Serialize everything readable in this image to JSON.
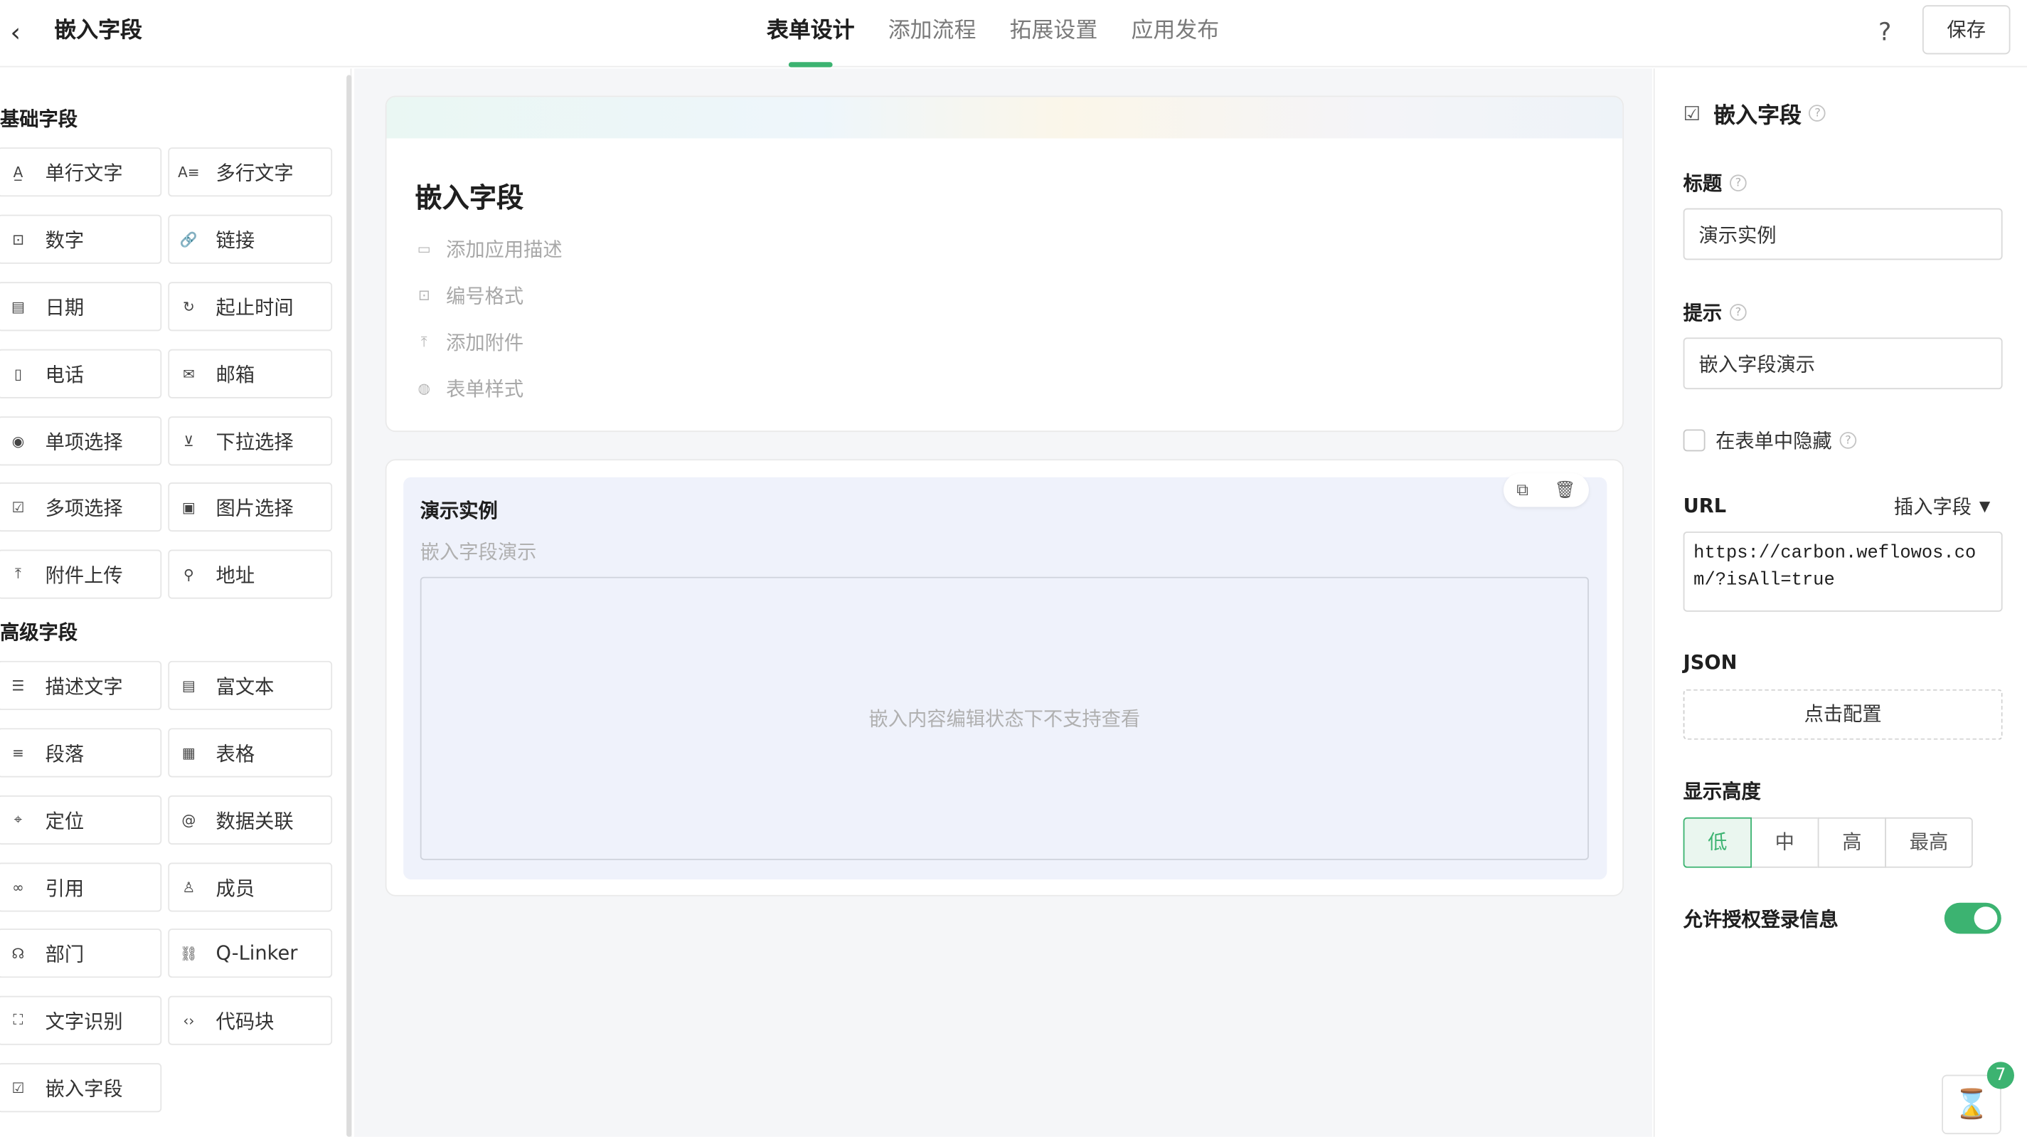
{
  "header": {
    "back_icon": "chevron-left-icon",
    "title": "嵌入字段",
    "tabs": [
      {
        "label": "表单设计",
        "active": true
      },
      {
        "label": "添加流程",
        "active": false
      },
      {
        "label": "拓展设置",
        "active": false
      },
      {
        "label": "应用发布",
        "active": false
      }
    ],
    "help_label": "?",
    "save_label": "保存"
  },
  "palette": {
    "basic_title": "基础字段",
    "basic_fields": [
      {
        "label": "单行文字",
        "icon": "text-icon"
      },
      {
        "label": "多行文字",
        "icon": "multiline-icon"
      },
      {
        "label": "数字",
        "icon": "number-icon"
      },
      {
        "label": "链接",
        "icon": "link-icon"
      },
      {
        "label": "日期",
        "icon": "calendar-icon"
      },
      {
        "label": "起止时间",
        "icon": "time-range-icon"
      },
      {
        "label": "电话",
        "icon": "phone-icon"
      },
      {
        "label": "邮箱",
        "icon": "mail-icon"
      },
      {
        "label": "单项选择",
        "icon": "radio-icon"
      },
      {
        "label": "下拉选择",
        "icon": "dropdown-icon"
      },
      {
        "label": "多项选择",
        "icon": "checkbox-icon"
      },
      {
        "label": "图片选择",
        "icon": "image-icon"
      },
      {
        "label": "附件上传",
        "icon": "upload-icon"
      },
      {
        "label": "地址",
        "icon": "address-icon"
      }
    ],
    "advanced_title": "高级字段",
    "advanced_fields": [
      {
        "label": "描述文字",
        "icon": "description-icon"
      },
      {
        "label": "富文本",
        "icon": "rich-text-icon"
      },
      {
        "label": "段落",
        "icon": "paragraph-icon"
      },
      {
        "label": "表格",
        "icon": "table-icon"
      },
      {
        "label": "定位",
        "icon": "location-icon"
      },
      {
        "label": "数据关联",
        "icon": "data-link-icon"
      },
      {
        "label": "引用",
        "icon": "reference-icon"
      },
      {
        "label": "成员",
        "icon": "member-icon"
      },
      {
        "label": "部门",
        "icon": "department-icon"
      },
      {
        "label": "Q-Linker",
        "icon": "qlinker-icon"
      },
      {
        "label": "文字识别",
        "icon": "ocr-icon"
      },
      {
        "label": "代码块",
        "icon": "code-icon"
      },
      {
        "label": "嵌入字段",
        "icon": "embed-icon"
      }
    ]
  },
  "form": {
    "title": "嵌入字段",
    "meta": [
      {
        "label": "添加应用描述",
        "icon": "comment-icon"
      },
      {
        "label": "编号格式",
        "icon": "number-format-icon"
      },
      {
        "label": "添加附件",
        "icon": "attachment-icon"
      },
      {
        "label": "表单样式",
        "icon": "palette-icon"
      }
    ],
    "field": {
      "label": "演示实例",
      "hint": "嵌入字段演示",
      "embed_message": "嵌入内容编辑状态下不支持查看",
      "copy_icon": "copy-icon",
      "delete_icon": "trash-icon"
    }
  },
  "settings": {
    "heading": "嵌入字段",
    "title_label": "标题",
    "title_value": "演示实例",
    "hint_label": "提示",
    "hint_value": "嵌入字段演示",
    "hide_label": "在表单中隐藏",
    "url_label": "URL",
    "insert_field_label": "插入字段",
    "url_value": "https://carbon.weflowos.com/?isAll=true",
    "json_label": "JSON",
    "config_label": "点击配置",
    "height_label": "显示高度",
    "height_options": [
      "低",
      "中",
      "高",
      "最高"
    ],
    "height_selected": "低",
    "auth_label": "允许授权登录信息",
    "auth_enabled": true
  },
  "floating": {
    "icon": "hourglass-icon",
    "badge": "7"
  },
  "colors": {
    "accent": "#3cb371",
    "canvas_bg": "#f5f6f8",
    "field_bg": "#eff2fb"
  }
}
